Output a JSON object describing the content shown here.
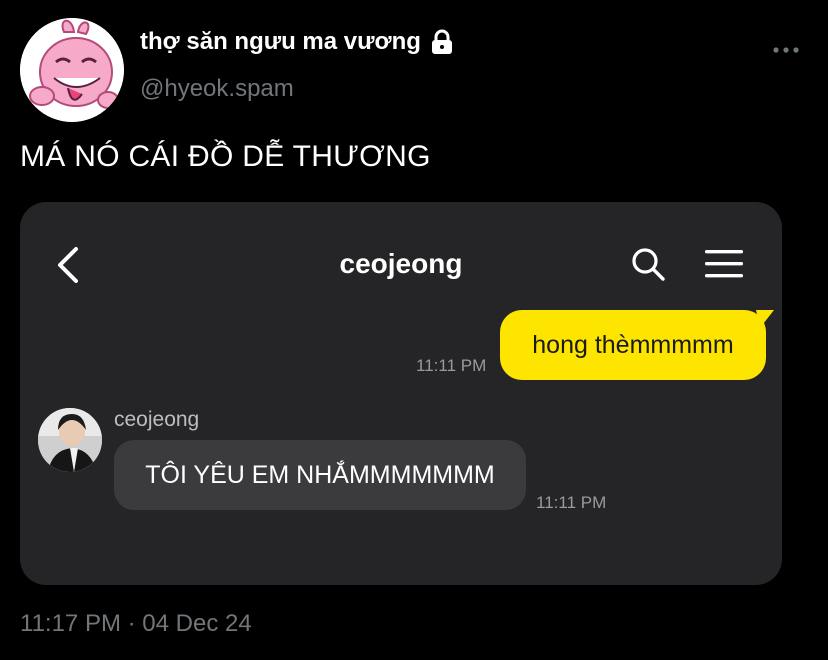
{
  "tweet": {
    "display_name": "thợ săn ngưu ma vương",
    "handle": "@hyeok.spam",
    "text": "MÁ NÓ CÁI ĐỒ DỄ THƯƠNG",
    "time": "11:17 PM",
    "separator": "·",
    "date": "04 Dec 24",
    "icons": {
      "lock": "lock-icon",
      "more": "more-icon"
    }
  },
  "chat": {
    "title": "ceojeong",
    "icons": {
      "back": "back-icon",
      "search": "search-icon",
      "menu": "menu-icon"
    },
    "sent": {
      "text": "hong thèmmmmm",
      "time": "11:11 PM"
    },
    "received": {
      "sender": "ceojeong",
      "text": "TÔI YÊU EM NHẮMMMMMMM",
      "time": "11:11 PM"
    }
  },
  "colors": {
    "background": "#000000",
    "muted_text": "#71767b",
    "card": "#252527",
    "sent_bubble": "#fee500",
    "received_bubble": "#3b3b3e"
  }
}
